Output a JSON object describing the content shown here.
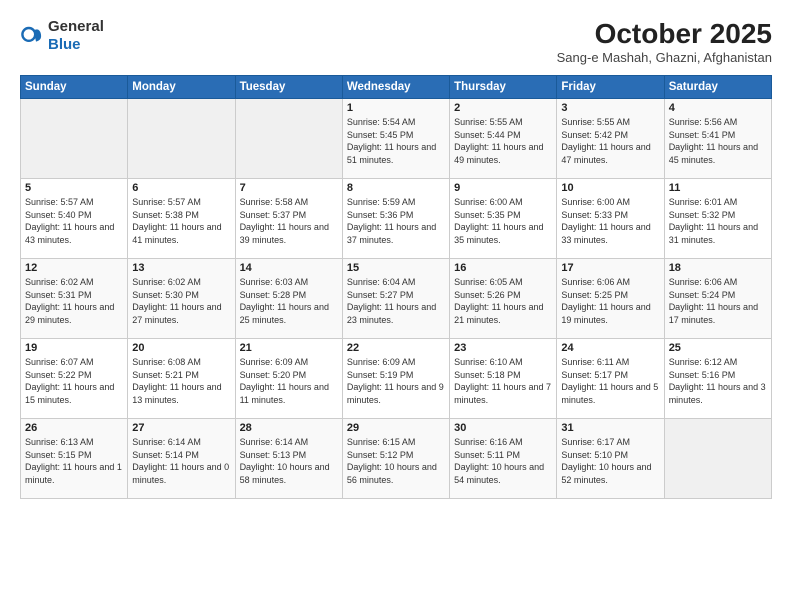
{
  "logo": {
    "general": "General",
    "blue": "Blue"
  },
  "title": "October 2025",
  "subtitle": "Sang-e Mashah, Ghazni, Afghanistan",
  "days_of_week": [
    "Sunday",
    "Monday",
    "Tuesday",
    "Wednesday",
    "Thursday",
    "Friday",
    "Saturday"
  ],
  "weeks": [
    [
      {
        "day": "",
        "info": ""
      },
      {
        "day": "",
        "info": ""
      },
      {
        "day": "",
        "info": ""
      },
      {
        "day": "1",
        "info": "Sunrise: 5:54 AM\nSunset: 5:45 PM\nDaylight: 11 hours and 51 minutes."
      },
      {
        "day": "2",
        "info": "Sunrise: 5:55 AM\nSunset: 5:44 PM\nDaylight: 11 hours and 49 minutes."
      },
      {
        "day": "3",
        "info": "Sunrise: 5:55 AM\nSunset: 5:42 PM\nDaylight: 11 hours and 47 minutes."
      },
      {
        "day": "4",
        "info": "Sunrise: 5:56 AM\nSunset: 5:41 PM\nDaylight: 11 hours and 45 minutes."
      }
    ],
    [
      {
        "day": "5",
        "info": "Sunrise: 5:57 AM\nSunset: 5:40 PM\nDaylight: 11 hours and 43 minutes."
      },
      {
        "day": "6",
        "info": "Sunrise: 5:57 AM\nSunset: 5:38 PM\nDaylight: 11 hours and 41 minutes."
      },
      {
        "day": "7",
        "info": "Sunrise: 5:58 AM\nSunset: 5:37 PM\nDaylight: 11 hours and 39 minutes."
      },
      {
        "day": "8",
        "info": "Sunrise: 5:59 AM\nSunset: 5:36 PM\nDaylight: 11 hours and 37 minutes."
      },
      {
        "day": "9",
        "info": "Sunrise: 6:00 AM\nSunset: 5:35 PM\nDaylight: 11 hours and 35 minutes."
      },
      {
        "day": "10",
        "info": "Sunrise: 6:00 AM\nSunset: 5:33 PM\nDaylight: 11 hours and 33 minutes."
      },
      {
        "day": "11",
        "info": "Sunrise: 6:01 AM\nSunset: 5:32 PM\nDaylight: 11 hours and 31 minutes."
      }
    ],
    [
      {
        "day": "12",
        "info": "Sunrise: 6:02 AM\nSunset: 5:31 PM\nDaylight: 11 hours and 29 minutes."
      },
      {
        "day": "13",
        "info": "Sunrise: 6:02 AM\nSunset: 5:30 PM\nDaylight: 11 hours and 27 minutes."
      },
      {
        "day": "14",
        "info": "Sunrise: 6:03 AM\nSunset: 5:28 PM\nDaylight: 11 hours and 25 minutes."
      },
      {
        "day": "15",
        "info": "Sunrise: 6:04 AM\nSunset: 5:27 PM\nDaylight: 11 hours and 23 minutes."
      },
      {
        "day": "16",
        "info": "Sunrise: 6:05 AM\nSunset: 5:26 PM\nDaylight: 11 hours and 21 minutes."
      },
      {
        "day": "17",
        "info": "Sunrise: 6:06 AM\nSunset: 5:25 PM\nDaylight: 11 hours and 19 minutes."
      },
      {
        "day": "18",
        "info": "Sunrise: 6:06 AM\nSunset: 5:24 PM\nDaylight: 11 hours and 17 minutes."
      }
    ],
    [
      {
        "day": "19",
        "info": "Sunrise: 6:07 AM\nSunset: 5:22 PM\nDaylight: 11 hours and 15 minutes."
      },
      {
        "day": "20",
        "info": "Sunrise: 6:08 AM\nSunset: 5:21 PM\nDaylight: 11 hours and 13 minutes."
      },
      {
        "day": "21",
        "info": "Sunrise: 6:09 AM\nSunset: 5:20 PM\nDaylight: 11 hours and 11 minutes."
      },
      {
        "day": "22",
        "info": "Sunrise: 6:09 AM\nSunset: 5:19 PM\nDaylight: 11 hours and 9 minutes."
      },
      {
        "day": "23",
        "info": "Sunrise: 6:10 AM\nSunset: 5:18 PM\nDaylight: 11 hours and 7 minutes."
      },
      {
        "day": "24",
        "info": "Sunrise: 6:11 AM\nSunset: 5:17 PM\nDaylight: 11 hours and 5 minutes."
      },
      {
        "day": "25",
        "info": "Sunrise: 6:12 AM\nSunset: 5:16 PM\nDaylight: 11 hours and 3 minutes."
      }
    ],
    [
      {
        "day": "26",
        "info": "Sunrise: 6:13 AM\nSunset: 5:15 PM\nDaylight: 11 hours and 1 minute."
      },
      {
        "day": "27",
        "info": "Sunrise: 6:14 AM\nSunset: 5:14 PM\nDaylight: 11 hours and 0 minutes."
      },
      {
        "day": "28",
        "info": "Sunrise: 6:14 AM\nSunset: 5:13 PM\nDaylight: 10 hours and 58 minutes."
      },
      {
        "day": "29",
        "info": "Sunrise: 6:15 AM\nSunset: 5:12 PM\nDaylight: 10 hours and 56 minutes."
      },
      {
        "day": "30",
        "info": "Sunrise: 6:16 AM\nSunset: 5:11 PM\nDaylight: 10 hours and 54 minutes."
      },
      {
        "day": "31",
        "info": "Sunrise: 6:17 AM\nSunset: 5:10 PM\nDaylight: 10 hours and 52 minutes."
      },
      {
        "day": "",
        "info": ""
      }
    ]
  ]
}
